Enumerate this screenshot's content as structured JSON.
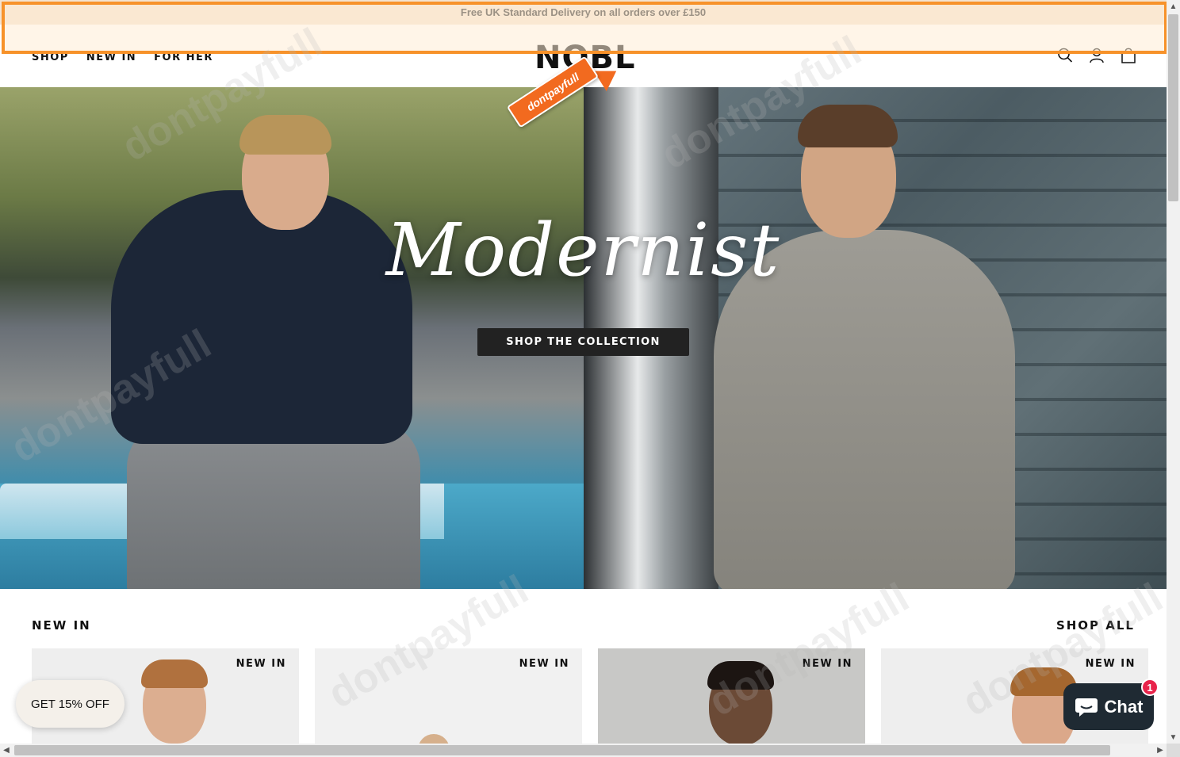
{
  "announcement": {
    "text": "Free UK Standard Delivery on all orders over £150"
  },
  "header": {
    "logo": "NOBL",
    "nav": [
      {
        "label": "SHOP"
      },
      {
        "label": "NEW IN"
      },
      {
        "label": "FOR HER"
      }
    ],
    "icons": [
      "search-icon",
      "account-icon",
      "cart-icon"
    ]
  },
  "brand_tag": {
    "text": "dontpayfull"
  },
  "hero": {
    "title": "Modernist",
    "cta": "SHOP THE COLLECTION"
  },
  "new_in": {
    "title": "NEW IN",
    "shop_all": "SHOP ALL",
    "cards": [
      {
        "badge": "NEW IN"
      },
      {
        "badge": "NEW IN"
      },
      {
        "badge": "NEW IN"
      },
      {
        "badge": "NEW IN"
      }
    ]
  },
  "discount": {
    "label": "GET 15% OFF"
  },
  "chat": {
    "label": "Chat",
    "badge": "1"
  },
  "colors": {
    "accent": "#f7922a",
    "announcement_bg": "#f4e2cf",
    "chat_bg": "#1f2a33",
    "badge_red": "#e8234a"
  }
}
